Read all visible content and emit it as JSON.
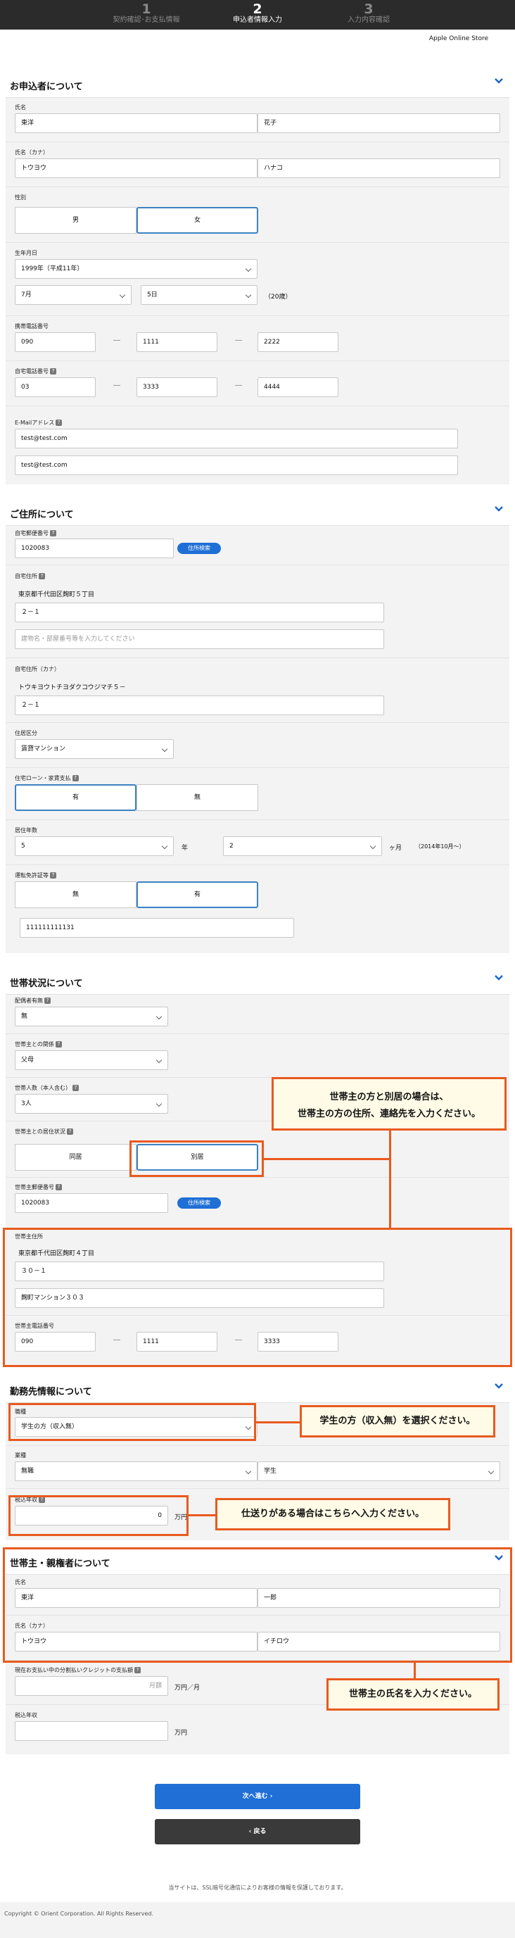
{
  "steps": [
    {
      "num": "1",
      "label": "契約確認･お支払情報"
    },
    {
      "num": "2",
      "label": "申込者情報入力"
    },
    {
      "num": "3",
      "label": "入力内容確認"
    }
  ],
  "store_name": "Apple Online Store",
  "applicant": {
    "title": "お申込者について",
    "name_label": "氏名",
    "last_name": "東洋",
    "first_name": "花子",
    "kana_label": "氏名（カナ）",
    "last_kana": "トウヨウ",
    "first_kana": "ハナコ",
    "gender_label": "性別",
    "gender_male": "男",
    "gender_female": "女",
    "birth_label": "生年月日",
    "birth_year": "1999年（平成11年）",
    "birth_month": "7月",
    "birth_day": "5日",
    "age": "（20歳）",
    "mobile_label": "携帯電話番号",
    "mobile": [
      "090",
      "1111",
      "2222"
    ],
    "home_phone_label": "自宅電話番号",
    "home_phone": [
      "03",
      "3333",
      "4444"
    ],
    "email_label": "E-Mailアドレス",
    "email": "test@test.com",
    "email_confirm": "test@test.com"
  },
  "address": {
    "title": "ご住所について",
    "zip_label": "自宅郵便番号",
    "zip": "1020083",
    "search_btn": "住所検索",
    "addr_label": "自宅住所",
    "addr_static": "東京都千代田区麹町５丁目",
    "addr_line1": "２－１",
    "addr_line2_placeholder": "建物名・部屋番号等を入力してください",
    "kana_label": "自宅住所（カナ）",
    "kana_static": "トウキヨウトチヨダクコウジマチ５－",
    "kana_line1": "２－１",
    "type_label": "住居区分",
    "type_value": "賃貸マンション",
    "loan_label": "住宅ローン・家賃支払",
    "loan_yes": "有",
    "loan_no": "無",
    "years_label": "居住年数",
    "years": "5",
    "years_unit": "年",
    "months": "2",
    "months_unit": "ヶ月",
    "since": "（2014年10月～）",
    "license_label": "運転免許証等",
    "license_no": "無",
    "license_yes": "有",
    "license_number": "111111111131"
  },
  "household": {
    "title": "世帯状況について",
    "spouse_label": "配偶者有無",
    "spouse": "無",
    "relation_label": "世帯主との関係",
    "relation": "父母",
    "count_label": "世帯人数（本人含む）",
    "count": "3人",
    "living_label": "世帯主との居住状況",
    "living_same": "同居",
    "living_separate": "別居",
    "head_zip_label": "世帯主郵便番号",
    "head_zip": "1020083",
    "search_btn": "住所検索",
    "head_addr_label": "世帯主住所",
    "head_addr_static": "東京都千代田区麹町４丁目",
    "head_addr_line1": "３０－１",
    "head_addr_line2": "麹町マンション３０３",
    "head_phone_label": "世帯主電話番号",
    "head_phone": [
      "090",
      "1111",
      "3333"
    ],
    "callout": [
      "世帯主の方と別居の場合は、",
      "世帯主の方の住所、連絡先を入力ください。"
    ]
  },
  "work": {
    "title": "勤務先情報について",
    "job_label": "職種",
    "job": "学生の方（収入無）",
    "industry_label": "業種",
    "industry": "無職",
    "industry2": "学生",
    "income_label": "税込年収",
    "income": "0",
    "income_unit": "万円",
    "callout_job": "学生の方（収入無）を選択ください。",
    "callout_income": "仕送りがある場合はこちらへ入力ください。"
  },
  "guardian": {
    "title": "世帯主・親権者について",
    "name_label": "氏名",
    "last_name": "東洋",
    "first_name": "一郎",
    "kana_label": "氏名（カナ）",
    "last_kana": "トウヨウ",
    "first_kana": "イチロウ",
    "credit_label": "現在お支払い中の分割払いクレジットの支払額",
    "credit_placeholder": "月額",
    "credit_unit": "万円／月",
    "income_label": "税込年収",
    "income_unit": "万円",
    "callout": "世帯主の氏名を入力ください。"
  },
  "buttons": {
    "next": "次へ進む ›",
    "back": "‹ 戻る"
  },
  "ssl_note": "当サイトは、SSL暗号化通信によりお客様の情報を保護しております。",
  "copyright": "Copyright © Orient Corporation. All Rights Reserved.",
  "colors": {
    "accent": "#3b82c4",
    "callout_border": "#e85a1f",
    "button_primary": "#1f6fd6",
    "button_secondary": "#3a3a3a"
  }
}
